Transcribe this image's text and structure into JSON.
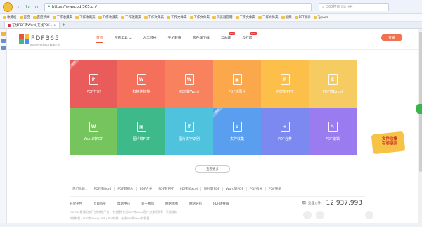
{
  "browser": {
    "url": "https://www.pdf365.cn/",
    "search_placeholder": "360搜索 Ctrl+K",
    "favorites": [
      "收藏栏",
      "百度",
      "百度新闻",
      "工作收藏夹",
      "工作收藏夹",
      "工作收藏夹",
      "工作收藏夹",
      "工作文件夹",
      "工作文件夹",
      "工作文件夹",
      "浏览器官网",
      "工作文件夹",
      "工作文件夹",
      "视频",
      "PPT助手",
      "Typora"
    ],
    "tab_title": "在线PDF转Word_在线PDF...",
    "status_left": "",
    "status_right": ""
  },
  "site": {
    "brand_name": "PDF365",
    "brand_tagline": "国内领先在线PDF转换平台",
    "nav": [
      {
        "label": "首页",
        "active": true,
        "hot": ""
      },
      {
        "label": "所有工具 ⌄",
        "active": false,
        "hot": ""
      },
      {
        "label": "人工转换",
        "active": false,
        "hot": ""
      },
      {
        "label": "手机转换",
        "active": false,
        "hot": ""
      },
      {
        "label": "客户端下载",
        "active": false,
        "hot": ""
      },
      {
        "label": "云收藏",
        "active": false,
        "hot": "HOT"
      },
      {
        "label": "云打印",
        "active": false,
        "hot": "HOT"
      }
    ],
    "login_label": "登录",
    "tiles": [
      {
        "label": "PDF打印",
        "icon": "print-icon",
        "color": "#ea5b5b",
        "corner": "推荐",
        "glyph": "P"
      },
      {
        "label": "扫描件转换",
        "icon": "scan-word-icon",
        "color": "#f4705a",
        "corner": "",
        "glyph": "W"
      },
      {
        "label": "PDF转Word",
        "icon": "pdf-to-word-icon",
        "color": "#f8825d",
        "corner": "",
        "glyph": "W"
      },
      {
        "label": "PDF转图片",
        "icon": "pdf-to-image-icon",
        "color": "#fba84c",
        "corner": "",
        "glyph": "▣"
      },
      {
        "label": "PDF转PPT",
        "icon": "pdf-to-ppt-icon",
        "color": "#fcc04a",
        "corner": "",
        "glyph": "P"
      },
      {
        "label": "PDF转Excel",
        "icon": "pdf-to-excel-icon",
        "color": "#f6cc62",
        "corner": "",
        "glyph": "E"
      },
      {
        "label": "Word转PDF",
        "icon": "word-to-pdf-icon",
        "color": "#75c45e",
        "corner": "",
        "glyph": "W"
      },
      {
        "label": "图片转PDF",
        "icon": "image-to-pdf-icon",
        "color": "#3eb98a",
        "corner": "",
        "glyph": "▣"
      },
      {
        "label": "图片文字识别",
        "icon": "ocr-icon",
        "color": "#4fc3de",
        "corner": "",
        "glyph": "T"
      },
      {
        "label": "文件收集",
        "icon": "file-collect-icon",
        "color": "#5a9ef0",
        "corner": "推荐",
        "glyph": "≡"
      },
      {
        "label": "PDF合并",
        "icon": "pdf-merge-icon",
        "color": "#7b89f0",
        "corner": "",
        "glyph": "+"
      },
      {
        "label": "PDF编辑",
        "icon": "pdf-edit-icon",
        "color": "#9a7cf0",
        "corner": "",
        "glyph": "✎"
      }
    ],
    "promo_lines": [
      "文件收集",
      "有奖测评"
    ],
    "more_label": "查看更多",
    "hot_label": "热门功能：",
    "hot_links": [
      "PDF转Word",
      "PDF转图片",
      "PDF合并",
      "PDF转PPT",
      "PDF转Excel",
      "图片转PDF",
      "Word转PDF",
      "PDF拆分",
      "PDF压缩"
    ],
    "footer_nav": [
      "开放平台",
      "立即购买",
      "帮助中心",
      "关于我们",
      "网站地图",
      "网站导航",
      "PDF转换器"
    ],
    "counter_label": "累计处理文件：",
    "counter_value": "12,937,993",
    "footer_desc": "PDF365是福昕旗下在线转换平台，专注提供在线PDF转Word/图片/文字识别等一系列服务",
    "footer_desc2": "文件转换   |   PDF转Word   |   PDF   |   PDF转换   |   在线PDF转Word转换器"
  }
}
